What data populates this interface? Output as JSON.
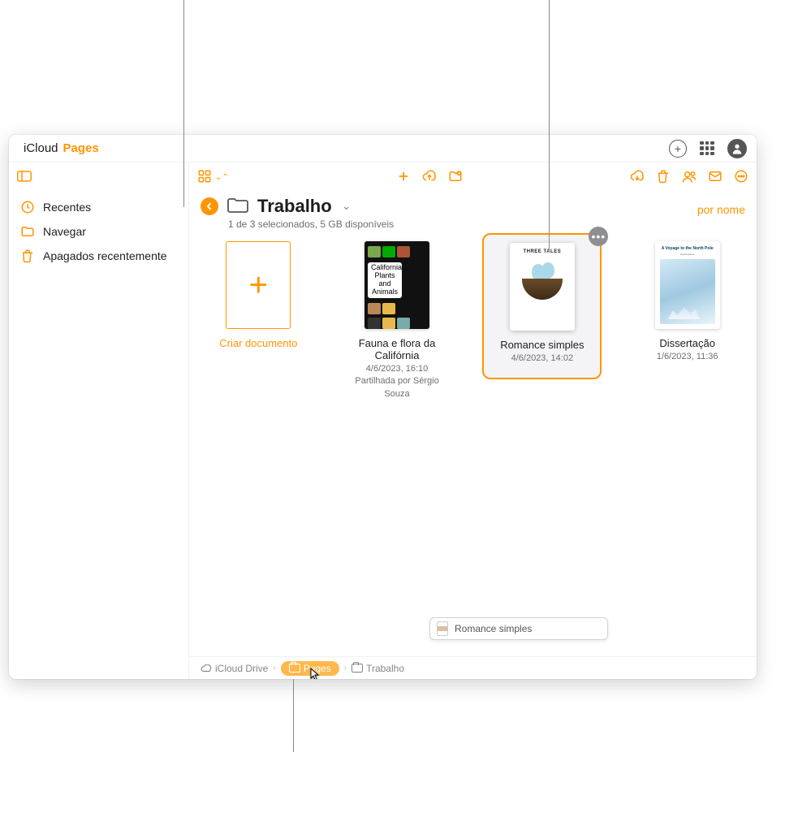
{
  "brand": {
    "icloud": "iCloud",
    "app": "Pages"
  },
  "sidebar": {
    "items": [
      {
        "label": "Recentes"
      },
      {
        "label": "Navegar"
      },
      {
        "label": "Apagados recentemente"
      }
    ]
  },
  "header": {
    "folder_name": "Trabalho",
    "status": "1 de 3 selecionados, 5 GB disponíveis",
    "sort_label": "por nome"
  },
  "create_tile": {
    "label": "Criar documento"
  },
  "documents": [
    {
      "title": "Fauna e flora da Califórnia",
      "date": "4/6/2023, 16:10",
      "shared": "Partilhada por Sérgio Souza",
      "thumb_label": "California Plants and Animals"
    },
    {
      "title": "Romance simples",
      "date": "4/6/2023, 14:02",
      "thumb_label": "THREE TALES",
      "selected": true
    },
    {
      "title": "Dissertação",
      "date": "1/6/2023, 11:36",
      "thumb_label": "A Voyage to the North Pole"
    }
  ],
  "drag": {
    "label": "Romance simples"
  },
  "breadcrumb": {
    "items": [
      {
        "label": "iCloud Drive"
      },
      {
        "label": "Pages",
        "drop_target": true
      },
      {
        "label": "Trabalho"
      }
    ]
  }
}
